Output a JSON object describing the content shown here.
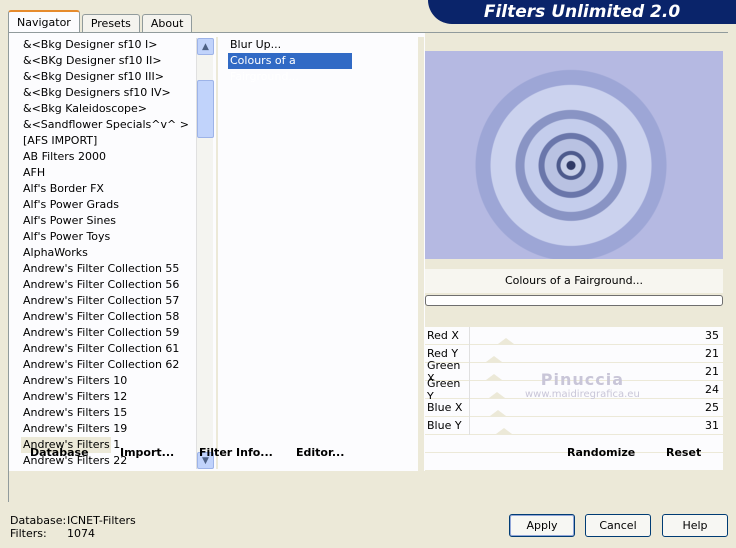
{
  "tabs": [
    "Navigator",
    "Presets",
    "About"
  ],
  "banner": "Filters Unlimited 2.0",
  "categories": [
    "&<Bkg Designer sf10 I>",
    "&<BKg Designer sf10 II>",
    "&<Bkg Designer sf10 III>",
    "&<Bkg Designers sf10 IV>",
    "&<Bkg Kaleidoscope>",
    "&<Sandflower Specials^v^ >",
    "[AFS IMPORT]",
    "AB Filters 2000",
    "AFH",
    "Alf's Border FX",
    "Alf's Power Grads",
    "Alf's Power Sines",
    "Alf's Power Toys",
    "AlphaWorks",
    "Andrew's Filter Collection 55",
    "Andrew's Filter Collection 56",
    "Andrew's Filter Collection 57",
    "Andrew's Filter Collection 58",
    "Andrew's Filter Collection 59",
    "Andrew's Filter Collection 61",
    "Andrew's Filter Collection 62",
    "Andrew's Filters 10",
    "Andrew's Filters 12",
    "Andrew's Filters 15",
    "Andrew's Filters 19",
    "Andrew's Filters 1",
    "Andrew's Filters 22"
  ],
  "filters": [
    "Blur Up...",
    "Colours of a Fairground..."
  ],
  "preview_title": "Colours of a Fairground...",
  "params": [
    {
      "label": "Red X",
      "value": "35"
    },
    {
      "label": "Red Y",
      "value": "21"
    },
    {
      "label": "Green X",
      "value": "21"
    },
    {
      "label": "Green Y",
      "value": "24"
    },
    {
      "label": "Blue X",
      "value": "25"
    },
    {
      "label": "Blue Y",
      "value": "31"
    }
  ],
  "bottom_links": {
    "database": "Database",
    "import": "Import...",
    "filter_info": "Filter Info...",
    "editor": "Editor...",
    "randomize": "Randomize",
    "reset": "Reset"
  },
  "status": {
    "database_label": "Database:",
    "database_value": "ICNET-Filters",
    "filters_label": "Filters:",
    "filters_value": "1074"
  },
  "buttons": {
    "apply": "Apply",
    "cancel": "Cancel",
    "help": "Help"
  },
  "watermark": {
    "line1": "Pinuccia",
    "line2": "www.maidiregrafica.eu"
  }
}
